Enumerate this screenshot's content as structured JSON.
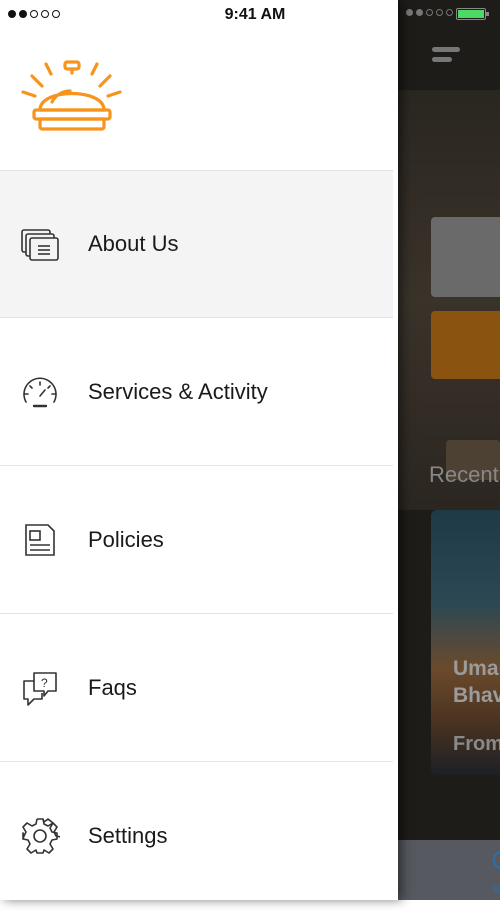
{
  "status_bar": {
    "time": "9:41 AM"
  },
  "drawer": {
    "logo_icon": "hotel-service-bell-icon",
    "accent_color": "#f7941d",
    "menu": [
      {
        "label": "About Us",
        "icon": "cards-icon",
        "active": true
      },
      {
        "label": "Services & Activity",
        "icon": "speedometer-icon",
        "active": false
      },
      {
        "label": "Policies",
        "icon": "document-icon",
        "active": false
      },
      {
        "label": "Faqs",
        "icon": "question-chat-icon",
        "active": false
      },
      {
        "label": "Settings",
        "icon": "gear-icon",
        "active": false
      }
    ]
  },
  "background_app": {
    "section_heading": "Recent",
    "card_title": "Uma\nBhav",
    "card_price_prefix": "From",
    "tab_label": "S"
  }
}
